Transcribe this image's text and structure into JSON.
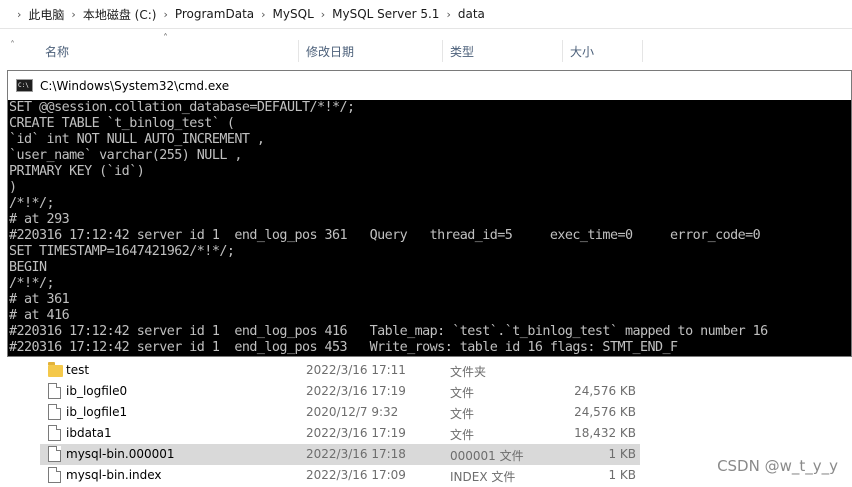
{
  "breadcrumb": [
    "此电脑",
    "本地磁盘 (C:)",
    "ProgramData",
    "MySQL",
    "MySQL Server 5.1",
    "data"
  ],
  "columns": {
    "name": "名称",
    "date": "修改日期",
    "type": "类型",
    "size": "大小"
  },
  "files": [
    {
      "name": "test",
      "date": "2022/3/16 17:11",
      "type": "文件夹",
      "size": "",
      "kind": "folder"
    },
    {
      "name": "ib_logfile0",
      "date": "2022/3/16 17:19",
      "type": "文件",
      "size": "24,576 KB",
      "kind": "file"
    },
    {
      "name": "ib_logfile1",
      "date": "2020/12/7 9:32",
      "type": "文件",
      "size": "24,576 KB",
      "kind": "file"
    },
    {
      "name": "ibdata1",
      "date": "2022/3/16 17:19",
      "type": "文件",
      "size": "18,432 KB",
      "kind": "file"
    },
    {
      "name": "mysql-bin.000001",
      "date": "2022/3/16 17:18",
      "type": "000001 文件",
      "size": "1 KB",
      "kind": "file",
      "selected": true
    },
    {
      "name": "mysql-bin.index",
      "date": "2022/3/16 17:09",
      "type": "INDEX 文件",
      "size": "1 KB",
      "kind": "file"
    }
  ],
  "cmd": {
    "title": "C:\\Windows\\System32\\cmd.exe",
    "lines": [
      "SET @@session.collation_database=DEFAULT/*!*/;",
      "CREATE TABLE `t_binlog_test` (",
      "`id` int NOT NULL AUTO_INCREMENT ,",
      "`user_name` varchar(255) NULL ,",
      "PRIMARY KEY (`id`)",
      ")",
      "/*!*/;",
      "# at 293",
      "#220316 17:12:42 server id 1  end_log_pos 361   Query   thread_id=5     exec_time=0     error_code=0",
      "SET TIMESTAMP=1647421962/*!*/;",
      "BEGIN",
      "/*!*/;",
      "# at 361",
      "# at 416",
      "#220316 17:12:42 server id 1  end_log_pos 416   Table_map: `test`.`t_binlog_test` mapped to number 16",
      "#220316 17:12:42 server id 1  end_log_pos 453   Write_rows: table id 16 flags: STMT_END_F"
    ]
  },
  "watermark": "CSDN @w_t_y_y"
}
